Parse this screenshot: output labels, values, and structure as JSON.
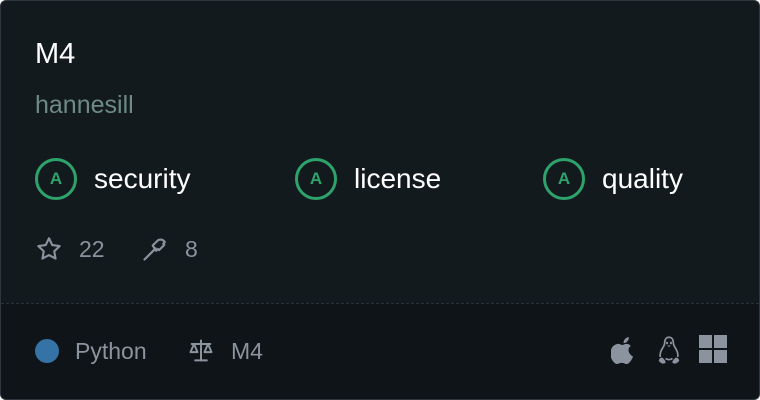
{
  "repo": {
    "name": "M4",
    "owner": "hannesill"
  },
  "scores": [
    {
      "grade": "A",
      "label": "security"
    },
    {
      "grade": "A",
      "label": "license"
    },
    {
      "grade": "A",
      "label": "quality"
    }
  ],
  "stats": {
    "stars": "22",
    "forks": "8"
  },
  "footer": {
    "language": "Python",
    "language_color": "#3572a5",
    "license": "M4",
    "platforms": [
      "apple-icon",
      "linux-icon",
      "windows-icon"
    ]
  },
  "colors": {
    "grade_accent": "#2ea26b",
    "card_background": "#131a1e"
  }
}
